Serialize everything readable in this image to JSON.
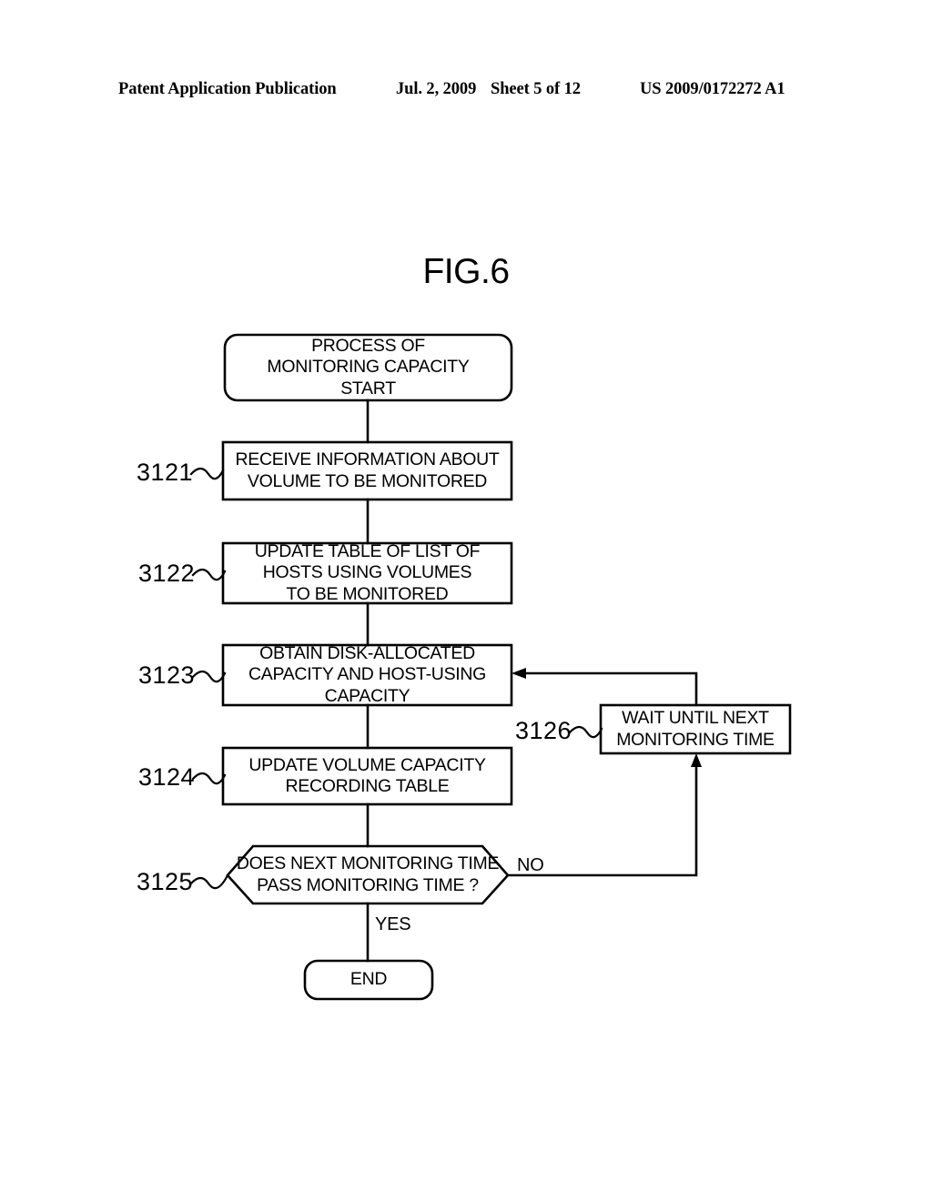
{
  "header": {
    "publication": "Patent Application Publication",
    "date": "Jul. 2, 2009",
    "sheet": "Sheet 5 of 12",
    "patent_number": "US 2009/0172272 A1"
  },
  "figure": {
    "title": "FIG.6",
    "line_color": "#000000",
    "background_color": "#ffffff"
  },
  "flowchart": {
    "nodes": [
      {
        "id": "start",
        "shape": "rounded-rect",
        "text": "PROCESS OF\nMONITORING CAPACITY\nSTART",
        "step": ""
      },
      {
        "id": "s3121",
        "shape": "rect",
        "text": "RECEIVE INFORMATION ABOUT\nVOLUME TO BE MONITORED",
        "step": "3121"
      },
      {
        "id": "s3122",
        "shape": "rect",
        "text": "UPDATE TABLE OF LIST OF\nHOSTS USING VOLUMES\nTO BE MONITORED",
        "step": "3122"
      },
      {
        "id": "s3123",
        "shape": "rect",
        "text": "OBTAIN DISK-ALLOCATED\nCAPACITY AND HOST-USING\nCAPACITY",
        "step": "3123"
      },
      {
        "id": "s3124",
        "shape": "rect",
        "text": "UPDATE VOLUME CAPACITY\nRECORDING TABLE",
        "step": "3124"
      },
      {
        "id": "s3125",
        "shape": "hexagon",
        "text": "DOES NEXT MONITORING TIME\nPASS MONITORING TIME ?",
        "step": "3125"
      },
      {
        "id": "s3126",
        "shape": "rect",
        "text": "WAIT UNTIL NEXT\nMONITORING TIME",
        "step": "3126"
      },
      {
        "id": "end",
        "shape": "rounded-rect",
        "text": "END",
        "step": ""
      }
    ],
    "edge_labels": {
      "no": "NO",
      "yes": "YES"
    }
  }
}
